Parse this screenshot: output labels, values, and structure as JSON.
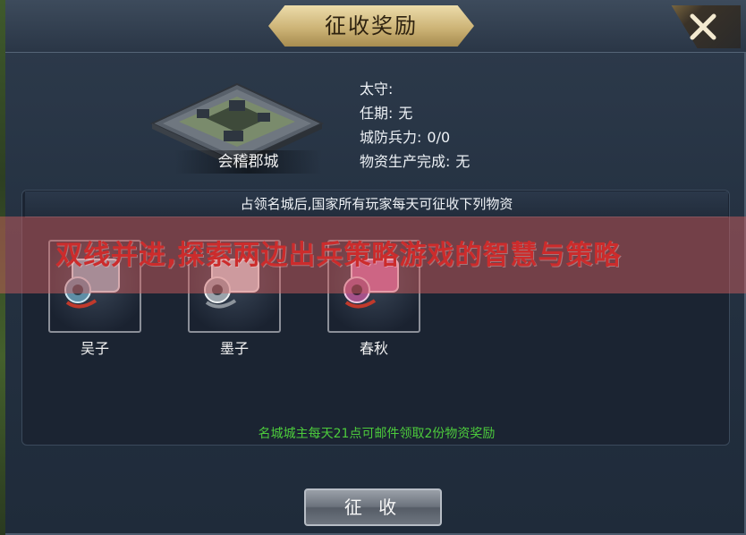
{
  "window": {
    "title": "征收奖励"
  },
  "city": {
    "name": "会稽郡城",
    "governor_label": "太守:",
    "governor_value": "",
    "term_label": "任期:",
    "term_value": "无",
    "defense_label": "城防兵力:",
    "defense_value": "0/0",
    "production_label": "物资生产完成:",
    "production_value": "无"
  },
  "panel": {
    "header": "占领名城后,国家所有玩家每天可征收下列物资",
    "items": [
      {
        "label": "吴子",
        "icon": "scroll-blue-icon"
      },
      {
        "label": "墨子",
        "icon": "scroll-white-icon"
      },
      {
        "label": "春秋",
        "icon": "scroll-pink-icon"
      }
    ],
    "reward_note": "名城城主每天21点可邮件领取2份物资奖励"
  },
  "banner": {
    "text": "双线并进,探索两边出兵策略游戏的智慧与策略"
  },
  "actions": {
    "collect_label": "征 收",
    "close_icon": "close-icon"
  },
  "colors": {
    "title_plate": "#cdb477",
    "reward_note": "#4ccb3c",
    "banner_text": "#cc2c2c"
  }
}
